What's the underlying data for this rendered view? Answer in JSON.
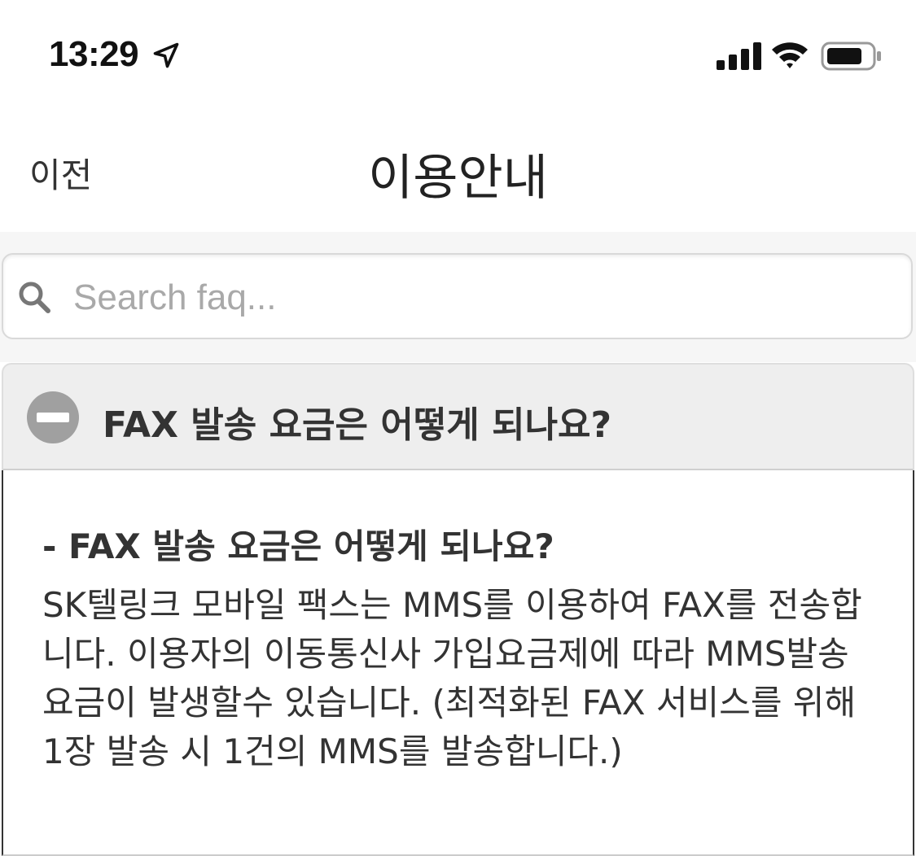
{
  "status_bar": {
    "time": "13:29",
    "icons": [
      "location-arrow-icon",
      "cellular-signal-icon",
      "wifi-icon",
      "battery-icon"
    ]
  },
  "nav": {
    "back_label": "이전",
    "title": "이용안내"
  },
  "search": {
    "placeholder": "Search faq...",
    "value": "",
    "icon": "search-icon"
  },
  "faq": {
    "item": {
      "question": "FAX 발송 요금은 어떻게 되나요?",
      "expanded": true,
      "toggle_icon": "minus-circle-icon",
      "answer_title": "- FAX 발송 요금은 어떻게 되나요?",
      "answer_text": "SK텔링크 모바일 팩스는 MMS를 이용하여 FAX를 전송합니다. 이용자의 이동통신사 가입요금제에 따라 MMS발송 요금이 발생할수 있습니다. (최적화된 FAX 서비스를 위해 1장 발송 시 1건의 MMS를 발송합니다.)"
    }
  },
  "colors": {
    "header_bg": "#eeeeee",
    "search_area_bg": "#f6f6f6",
    "icon_gray": "#a0a0a0",
    "text": "#333333"
  }
}
